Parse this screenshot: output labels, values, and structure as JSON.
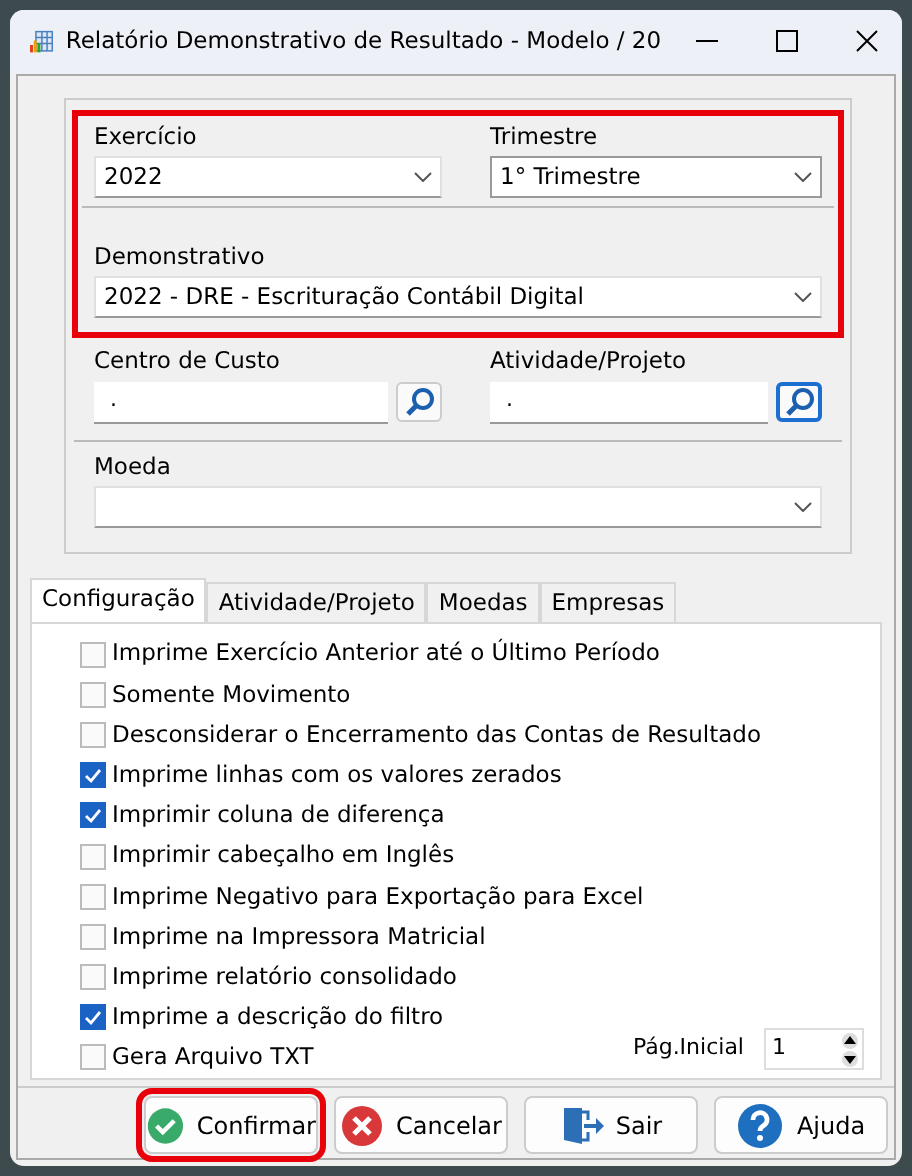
{
  "window": {
    "title": "Relatório Demonstrativo de Resultado - Modelo / 20"
  },
  "filters": {
    "highlighted": true,
    "exercicio": {
      "label": "Exercício",
      "value": "2022"
    },
    "trimestre": {
      "label": "Trimestre",
      "value": "1° Trimestre"
    },
    "demonstrativo": {
      "label": "Demonstrativo",
      "value": "2022 - DRE - Escrituração Contábil Digital"
    }
  },
  "centro_custo": {
    "label": "Centro de Custo",
    "value": "."
  },
  "atividade_projeto": {
    "label": "Atividade/Projeto",
    "value": ".",
    "focused": true
  },
  "moeda": {
    "label": "Moeda"
  },
  "tabs": [
    {
      "label": "Configuração",
      "selected": true
    },
    {
      "label": "Atividade/Projeto",
      "selected": false
    },
    {
      "label": "Moedas",
      "selected": false
    },
    {
      "label": "Empresas",
      "selected": false
    }
  ],
  "options": [
    {
      "label": "Imprime Exercício Anterior até o Último Período",
      "checked": false
    },
    {
      "label": "Somente Movimento",
      "checked": false
    },
    {
      "label": "Desconsiderar o Encerramento das Contas de Resultado",
      "checked": false
    },
    {
      "label": "Imprime linhas com os valores zerados",
      "checked": true
    },
    {
      "label": "Imprimir coluna de diferença",
      "checked": true
    },
    {
      "label": "Imprimir cabeçalho em Inglês",
      "checked": false
    },
    {
      "label": "Imprime Negativo para Exportação para Excel",
      "checked": false
    },
    {
      "label": "Imprime na Impressora Matricial",
      "checked": false
    },
    {
      "label": "Imprime relatório consolidado",
      "checked": false
    },
    {
      "label": "Imprime a descrição do filtro",
      "checked": true
    },
    {
      "label": "Gera Arquivo TXT",
      "checked": false
    }
  ],
  "pagina_inicial": {
    "label": "Pág.Inicial",
    "value": "1"
  },
  "buttons": [
    {
      "kind": "confirm",
      "label": "Confirmar",
      "highlighted": true
    },
    {
      "kind": "cancel",
      "label": "Cancelar",
      "highlighted": false
    },
    {
      "kind": "exit",
      "label": "Sair",
      "highlighted": false
    },
    {
      "kind": "help",
      "label": "Ajuda",
      "highlighted": false
    }
  ]
}
